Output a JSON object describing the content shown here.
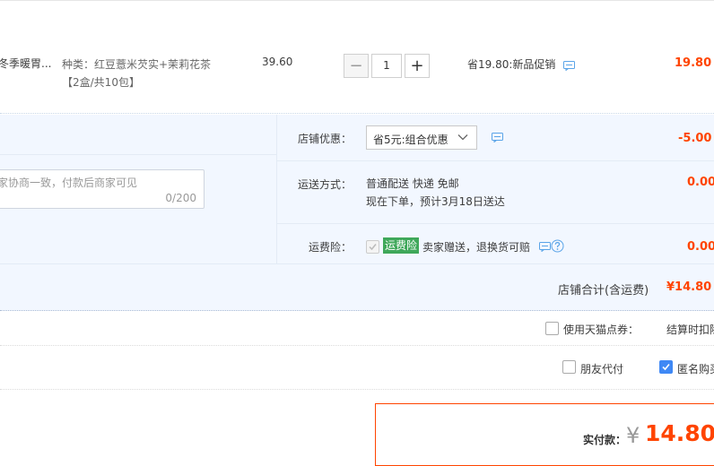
{
  "item": {
    "title_fragment": "冬季暖胃...",
    "spec_line1": "种类：红豆薏米芡实+茉莉花茶",
    "spec_line2": "【2盒/共10包】",
    "unit_price": "39.60",
    "qty_minus": "−",
    "qty_value": "1",
    "qty_plus": "+",
    "promo": "省19.80:新品促销",
    "subtotal": "19.80"
  },
  "shop": {
    "discount_label": "店铺优惠：",
    "discount_select": "省5元:组合优惠",
    "discount_amount": "-5.00",
    "message_placeholder": "家协商一致，付款后商家可见",
    "message_counter": "0/200",
    "shipping_label": "运送方式：",
    "shipping_method": "普通配送 快递 免邮",
    "shipping_eta": "现在下单，预计3月18日送达",
    "shipping_amount": "0.00",
    "insurance_label": "运费险：",
    "insurance_badge": "运费险",
    "insurance_text": "卖家赠送，退换货可赔",
    "insurance_amount": "0.00",
    "total_label": "店铺合计(含运费)",
    "total_amount": "¥14.80"
  },
  "options": {
    "tmall_points_label": "使用天猫点券：",
    "settle_note": "结算时扣除",
    "friend_pay_label": "朋友代付",
    "anonymous_label": "匿名购买"
  },
  "payment": {
    "label": "实付款：",
    "currency": "¥",
    "amount": "14.80"
  },
  "colors": {
    "accent_red": "#ff4400",
    "panel_bg": "#f2f7ff",
    "check_blue": "#3f88f5",
    "insurance_green": "#3fa85a"
  }
}
